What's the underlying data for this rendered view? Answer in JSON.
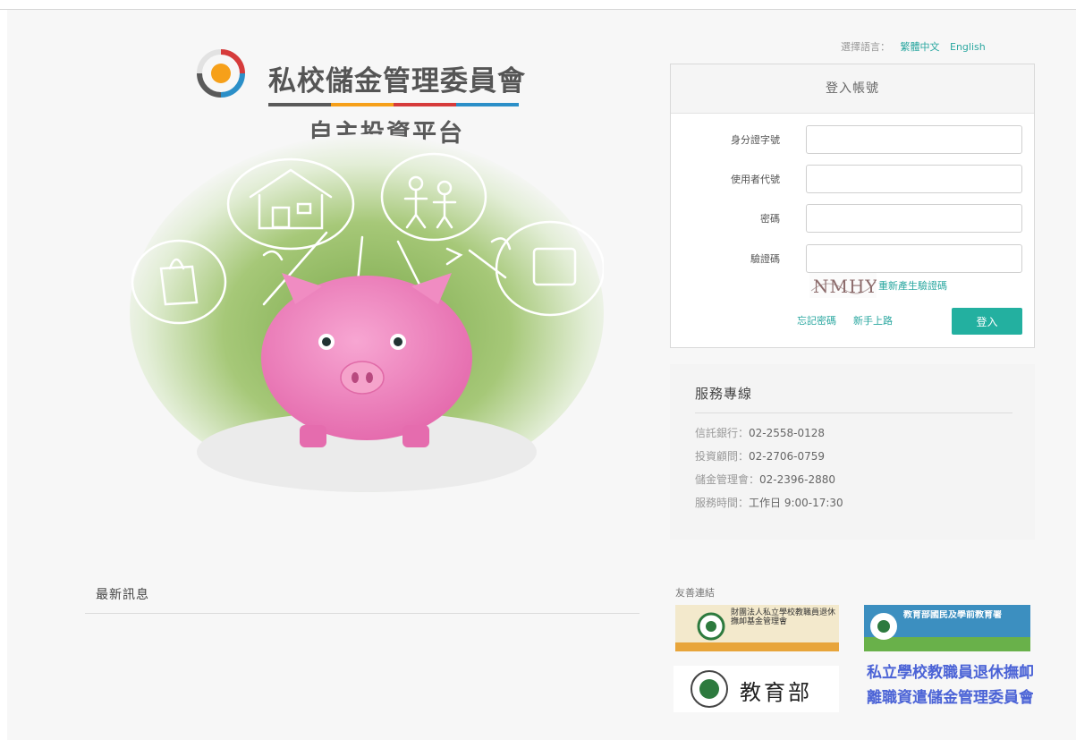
{
  "logo": {
    "title": "私校儲金管理委員會",
    "subtitle": "自主投資平台",
    "bar_colors": [
      "#5a5a5a",
      "#f6a01a",
      "#d63b3b",
      "#2b8fc8"
    ]
  },
  "language": {
    "label": "選擇語言：",
    "options": [
      "繁體中文",
      "English"
    ]
  },
  "login": {
    "header": "登入帳號",
    "fields": [
      {
        "label": "身分證字號",
        "value": ""
      },
      {
        "label": "使用者代號",
        "value": ""
      },
      {
        "label": "密碼",
        "value": ""
      },
      {
        "label": "驗證碼",
        "value": ""
      }
    ],
    "captcha_text": "NMHY",
    "refresh_label": "重新產生驗證碼",
    "forgot_label": "忘記密碼",
    "newbie_label": "新手上路",
    "submit_label": "登入",
    "accent_color": "#23b0a0"
  },
  "service": {
    "title": "服務專線",
    "rows": [
      {
        "label": "信託銀行：",
        "value": "02-2558-0128"
      },
      {
        "label": "投資顧問：",
        "value": "02-2706-0759"
      },
      {
        "label": "儲金管理會：",
        "value": "02-2396-2880"
      },
      {
        "label": "服務時間：",
        "value": "工作日 9:00-17:30"
      }
    ]
  },
  "news": {
    "title": "最新訊息"
  },
  "friends": {
    "title": "友善連結",
    "banners": [
      {
        "icon": "foundation-logo-icon",
        "text": "財團法人私立學校教職員退休撫卹基金管理會"
      },
      {
        "icon": "moe-k12-logo-icon",
        "text": "教育部國民及學前教育署"
      },
      {
        "icon": "moe-logo-icon",
        "text": "教育部"
      },
      {
        "text_line1": "私立學校教職員退休撫卹",
        "text_line2": "離職資遣儲金管理委員會"
      }
    ]
  }
}
